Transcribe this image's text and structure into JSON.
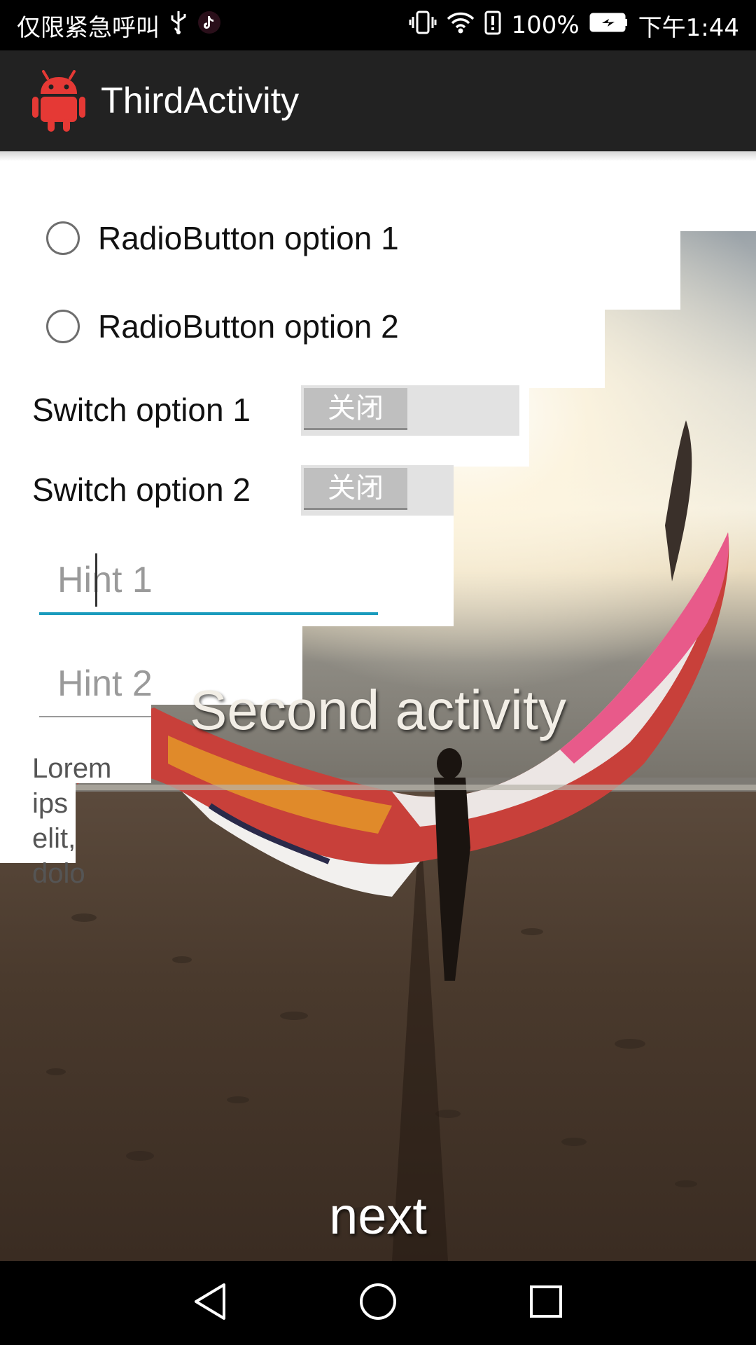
{
  "status_bar": {
    "carrier": "仅限紧急呼叫",
    "battery": "100%",
    "time": "下午1:44"
  },
  "app_bar": {
    "title": "ThirdActivity"
  },
  "radios": [
    {
      "label": "RadioButton option 1"
    },
    {
      "label": "RadioButton option 2"
    }
  ],
  "switches": [
    {
      "label": "Switch option 1",
      "state": "关闭"
    },
    {
      "label": "Switch option 2",
      "state": "关闭"
    }
  ],
  "inputs": [
    {
      "placeholder": "Hint 1",
      "value": ""
    },
    {
      "placeholder": "Hint 2",
      "value": ""
    }
  ],
  "lorem": {
    "line1": "Lorem ips",
    "line2": "elit,",
    "line3": "dolo"
  },
  "overlay": {
    "title": "Second activity",
    "next_label": "next"
  },
  "colors": {
    "accent": "#1a9bbd",
    "appbar": "#222222",
    "android_red": "#e53935"
  }
}
